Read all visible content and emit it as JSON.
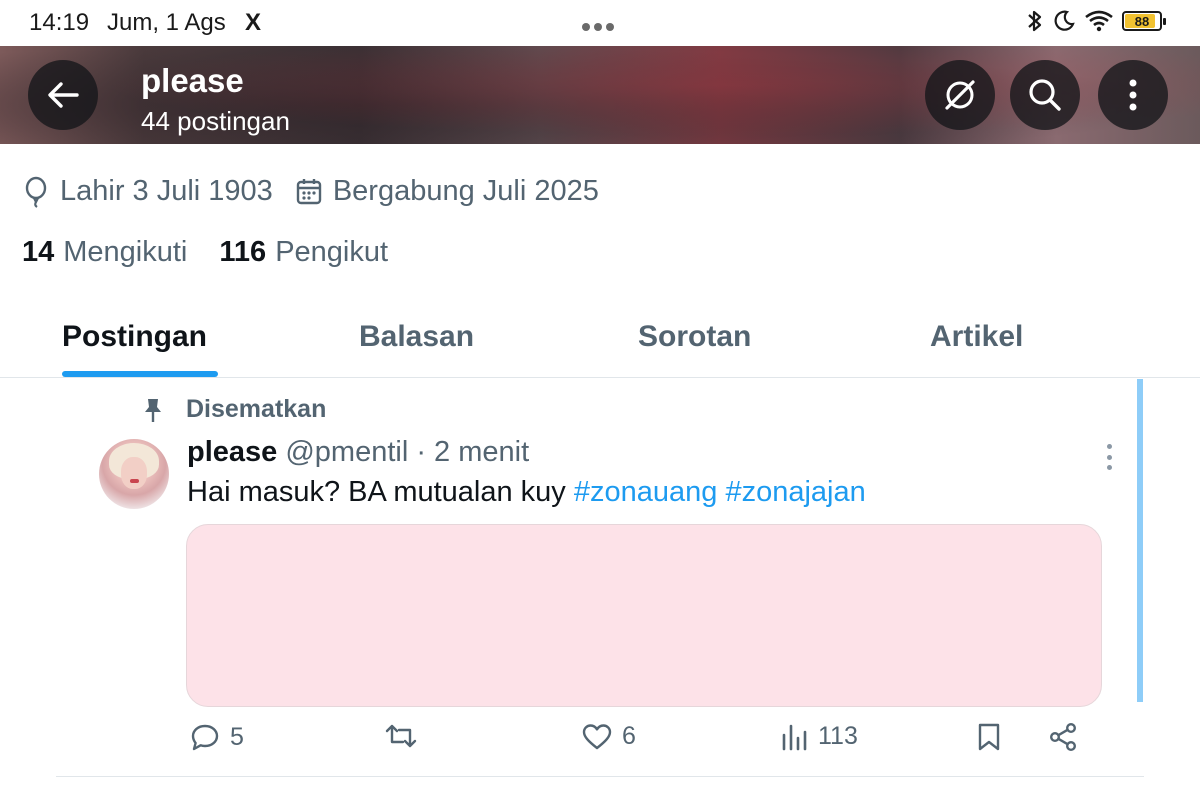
{
  "status_bar": {
    "time": "14:19",
    "date": "Jum, 1 Ags",
    "app_icon": "X",
    "battery": "88",
    "battery_level": 0.88,
    "icons": [
      "bluetooth-icon",
      "moon-icon",
      "wifi-icon",
      "battery-icon"
    ]
  },
  "header": {
    "name": "please",
    "post_count": "44 postingan"
  },
  "profile": {
    "birthday": "Lahir 3 Juli 1903",
    "joined": "Bergabung Juli 2025",
    "following_count": "14",
    "following_label": "Mengikuti",
    "followers_count": "116",
    "followers_label": "Pengikut"
  },
  "tabs": [
    {
      "label": "Postingan",
      "active": true
    },
    {
      "label": "Balasan",
      "active": false
    },
    {
      "label": "Sorotan",
      "active": false
    },
    {
      "label": "Artikel",
      "active": false
    }
  ],
  "post": {
    "pinned_label": "Disematkan",
    "author_name": "please",
    "author_handle": "@pmentil · 2 menit",
    "text_plain": "Hai masuk? BA mutualan kuy ",
    "hashtag_1": "#zonauang",
    "hashtag_2": "#zonajajan",
    "media_color": "#fde2e8",
    "replies": "5",
    "likes": "6",
    "views": "113"
  },
  "colors": {
    "accent": "#1d9bf0",
    "secondary_text": "#536471",
    "primary_text": "#0f1419"
  }
}
